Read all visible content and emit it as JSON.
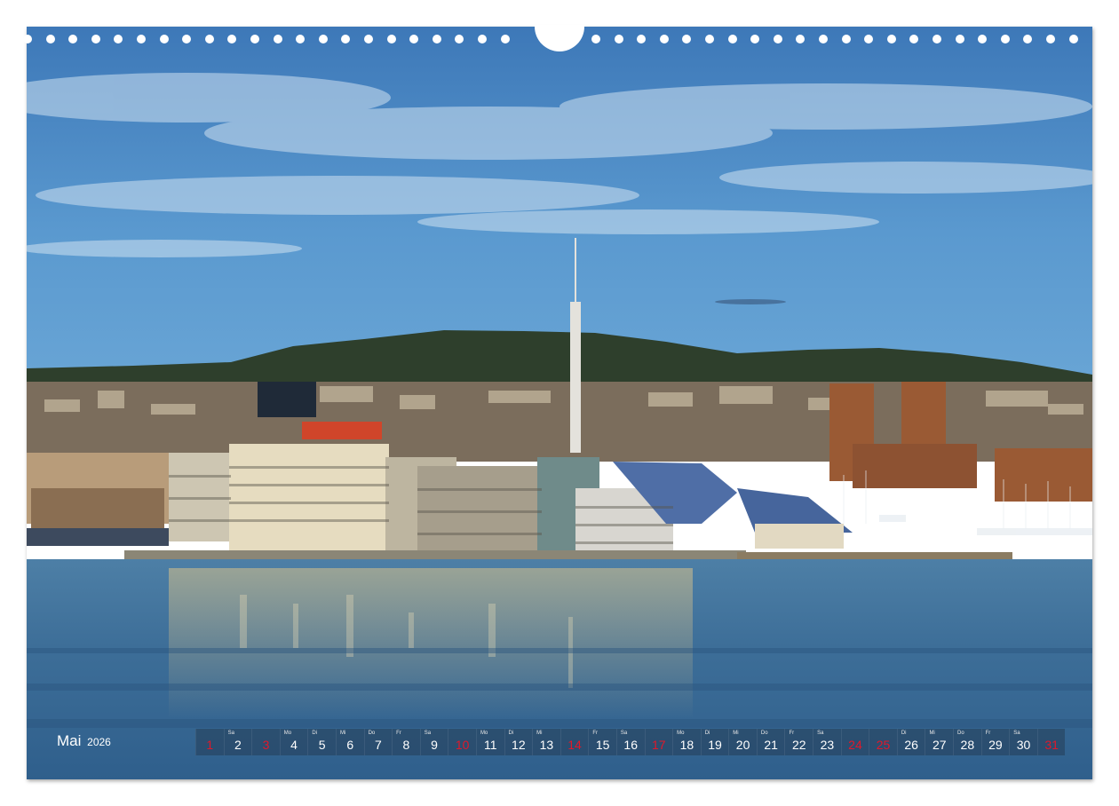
{
  "calendar": {
    "month": "Mai",
    "year": "2026",
    "days": [
      {
        "n": "1",
        "wd": "",
        "red": true
      },
      {
        "n": "2",
        "wd": "Sa",
        "red": false
      },
      {
        "n": "3",
        "wd": "",
        "red": true
      },
      {
        "n": "4",
        "wd": "Mo",
        "red": false
      },
      {
        "n": "5",
        "wd": "Di",
        "red": false
      },
      {
        "n": "6",
        "wd": "Mi",
        "red": false
      },
      {
        "n": "7",
        "wd": "Do",
        "red": false
      },
      {
        "n": "8",
        "wd": "Fr",
        "red": false
      },
      {
        "n": "9",
        "wd": "Sa",
        "red": false
      },
      {
        "n": "10",
        "wd": "",
        "red": true
      },
      {
        "n": "11",
        "wd": "Mo",
        "red": false
      },
      {
        "n": "12",
        "wd": "Di",
        "red": false
      },
      {
        "n": "13",
        "wd": "Mi",
        "red": false
      },
      {
        "n": "14",
        "wd": "",
        "red": true
      },
      {
        "n": "15",
        "wd": "Fr",
        "red": false
      },
      {
        "n": "16",
        "wd": "Sa",
        "red": false
      },
      {
        "n": "17",
        "wd": "",
        "red": true
      },
      {
        "n": "18",
        "wd": "Mo",
        "red": false
      },
      {
        "n": "19",
        "wd": "Di",
        "red": false
      },
      {
        "n": "20",
        "wd": "Mi",
        "red": false
      },
      {
        "n": "21",
        "wd": "Do",
        "red": false
      },
      {
        "n": "22",
        "wd": "Fr",
        "red": false
      },
      {
        "n": "23",
        "wd": "Sa",
        "red": false
      },
      {
        "n": "24",
        "wd": "",
        "red": true
      },
      {
        "n": "25",
        "wd": "",
        "red": true
      },
      {
        "n": "26",
        "wd": "Di",
        "red": false
      },
      {
        "n": "27",
        "wd": "Mi",
        "red": false
      },
      {
        "n": "28",
        "wd": "Do",
        "red": false
      },
      {
        "n": "29",
        "wd": "Fr",
        "red": false
      },
      {
        "n": "30",
        "wd": "Sa",
        "red": false
      },
      {
        "n": "31",
        "wd": "",
        "red": true
      }
    ]
  },
  "colors": {
    "sky_top": "#3f7fc0",
    "sky_bottom": "#5d9fd2",
    "water": "#3a6d9a",
    "holiday_red": "#e0182a"
  }
}
